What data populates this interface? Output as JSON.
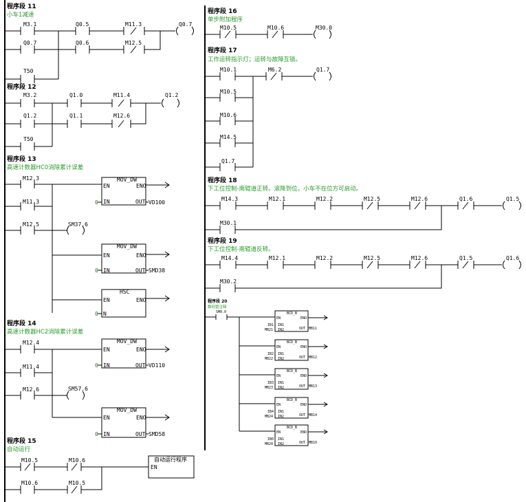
{
  "networks": {
    "n11": {
      "title": "程序段 11",
      "comment": "小车1减速",
      "contacts": [
        "M3.1",
        "Q0.5",
        "M11.3",
        "Q0.7",
        "Q0.6",
        "M12.5",
        "T50"
      ],
      "coil": "Q0.7"
    },
    "n12": {
      "title": "程序段 12",
      "comment": "",
      "contacts": [
        "M3.2",
        "Q1.0",
        "M11.4",
        "Q1.2",
        "Q1.1",
        "M12.6",
        "T50"
      ],
      "coil": "Q1.2"
    },
    "n13": {
      "title": "程序段 13",
      "comment": "高速计数器HC0消除累计误差",
      "contacts": [
        "M12.3",
        "M11.3",
        "M12.5"
      ],
      "coil": "SM37.6",
      "boxes": [
        {
          "name": "MOV_DW",
          "en": "EN",
          "eno": "ENO",
          "in_pin": "IN",
          "out_pin": "OUT",
          "in_val": "0",
          "out_val": "VD100"
        },
        {
          "name": "MOV_DW",
          "en": "EN",
          "eno": "ENO",
          "in_pin": "IN",
          "out_pin": "OUT",
          "in_val": "0",
          "out_val": "SMD38"
        },
        {
          "name": "HSC",
          "en": "EN",
          "eno": "ENO",
          "in_pin": "N",
          "in_val": "0"
        }
      ]
    },
    "n14": {
      "title": "程序段 14",
      "comment": "高速计数器HC2消除累计误差",
      "contacts": [
        "M12.4",
        "M11.4",
        "M12.6"
      ],
      "coil": "SM57.6",
      "boxes": [
        {
          "name": "MOV_DW",
          "en": "EN",
          "eno": "ENO",
          "in_pin": "IN",
          "out_pin": "OUT",
          "in_val": "0",
          "out_val": "VD110"
        },
        {
          "name": "MOV_DW",
          "en": "EN",
          "eno": "ENO",
          "in_pin": "IN",
          "out_pin": "OUT",
          "in_val": "0",
          "out_val": "SMD58"
        }
      ]
    },
    "n15": {
      "title": "程序段 15",
      "comment": "自动运行",
      "contacts": [
        "M10.5",
        "M10.6",
        "M10.6",
        "M10.5"
      ],
      "box": {
        "name": "自动运行程序",
        "en": "EN"
      }
    },
    "n16": {
      "title": "程序段 16",
      "comment": "单步附加程序",
      "contacts": [
        "M10.5",
        "M10.6"
      ],
      "coil": "M30.0"
    },
    "n17": {
      "title": "程序段 17",
      "comment": "工作运转指示灯；运转与故障互锁。",
      "contacts": [
        "M10.1",
        "M6.2",
        "M10.5",
        "M10.6",
        "M14.5",
        "Q1.7"
      ],
      "coil": "Q1.7"
    },
    "n18": {
      "title": "程序段 18",
      "comment": "下工位控制-南辊道正转。滚降到位，小车不在位方可启动。",
      "contacts": [
        "M14.3",
        "M12.1",
        "M12.2",
        "M12.5",
        "M12.6",
        "Q1.6",
        "M30.1"
      ],
      "coil": "Q1.5"
    },
    "n19": {
      "title": "程序段 19",
      "comment": "下工位控制-南辊道反转。",
      "contacts": [
        "M14.4",
        "M12.1",
        "M12.2",
        "M12.5",
        "M12.6",
        "Q1.5",
        "M30.2"
      ],
      "coil": "Q1.6"
    },
    "n20": {
      "title": "程序段 20",
      "comment": "数码管注释",
      "contact": "SM0.0",
      "boxes": [
        {
          "name": "BCD_B",
          "en": "EN",
          "eno": "ENO",
          "in1": "IN1",
          "in2": "IN2",
          "out": "OUT",
          "in1_val": "IB1",
          "in2_val": "MB21",
          "out_val": "MB11"
        },
        {
          "name": "BCD_B",
          "en": "EN",
          "eno": "ENO",
          "in1": "IN1",
          "in2": "IN2",
          "out": "OUT",
          "in1_val": "IB2",
          "in2_val": "MB22",
          "out_val": "MB12"
        },
        {
          "name": "BCD_B",
          "en": "EN",
          "eno": "ENO",
          "in1": "IN1",
          "in2": "IN2",
          "out": "OUT",
          "in1_val": "IB3",
          "in2_val": "MB23",
          "out_val": "MB13"
        },
        {
          "name": "BCD_B",
          "en": "EN",
          "eno": "ENO",
          "in1": "IN1",
          "in2": "IN2",
          "out": "OUT",
          "in1_val": "IB4",
          "in2_val": "MB24",
          "out_val": "MB14"
        },
        {
          "name": "BCD_B",
          "en": "EN",
          "eno": "ENO",
          "in1": "IN1",
          "in2": "IN2",
          "out": "OUT",
          "in1_val": "IB0",
          "in2_val": "MB20",
          "out_val": "MB10"
        }
      ]
    }
  }
}
